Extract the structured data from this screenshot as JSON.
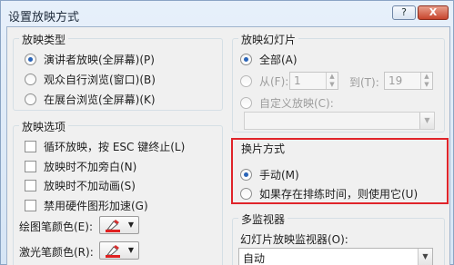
{
  "window": {
    "title": "设置放映方式",
    "help_label": "?",
    "close_label": "X"
  },
  "show_type": {
    "title": "放映类型",
    "options": [
      {
        "label": "演讲者放映(全屏幕)(P)",
        "selected": true
      },
      {
        "label": "观众自行浏览(窗口)(B)",
        "selected": false
      },
      {
        "label": "在展台浏览(全屏幕)(K)",
        "selected": false
      }
    ]
  },
  "show_options": {
    "title": "放映选项",
    "checks": [
      {
        "label": "循环放映，按 ESC 键终止(L)",
        "checked": false
      },
      {
        "label": "放映时不加旁白(N)",
        "checked": false
      },
      {
        "label": "放映时不加动画(S)",
        "checked": false
      },
      {
        "label": "禁用硬件图形加速(G)",
        "checked": false
      }
    ],
    "pen_color_label": "绘图笔颜色(E):",
    "laser_color_label": "激光笔颜色(R):",
    "pen_color": "#e02020",
    "laser_color": "#e02020"
  },
  "slides": {
    "title": "放映幻灯片",
    "all_label": "全部(A)",
    "from_label": "从(F):",
    "from_value": "1",
    "to_label": "到(T):",
    "to_value": "19",
    "custom_label": "自定义放映(C):",
    "custom_value": ""
  },
  "advance": {
    "title": "换片方式",
    "manual_label": "手动(M)",
    "timings_label": "如果存在排练时间，则使用它(U)",
    "highlight_color": "#e0242a"
  },
  "monitors": {
    "title": "多监视器",
    "monitor_label": "幻灯片放映监视器(O):",
    "monitor_value": "自动"
  }
}
